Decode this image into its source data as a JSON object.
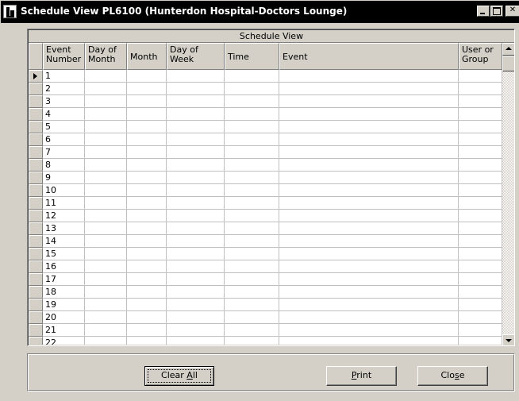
{
  "window": {
    "title": "Schedule View PL6100 (Hunterdon Hospital-Doctors Lounge)"
  },
  "grid": {
    "caption": "Schedule View",
    "columns": [
      {
        "label": "Event Number"
      },
      {
        "label": "Day of Month"
      },
      {
        "label": "Month"
      },
      {
        "label": "Day of Week"
      },
      {
        "label": "Time"
      },
      {
        "label": "Event"
      },
      {
        "label": "User or Group"
      }
    ],
    "rows": [
      "1",
      "2",
      "3",
      "4",
      "5",
      "6",
      "7",
      "8",
      "9",
      "10",
      "11",
      "12",
      "13",
      "14",
      "15",
      "16",
      "17",
      "18",
      "19",
      "20",
      "21",
      "22"
    ],
    "current_row": "1"
  },
  "buttons": {
    "clear_all": {
      "label": "Clear All",
      "mnemonic": "A"
    },
    "print": {
      "label": "Print",
      "mnemonic": "P"
    },
    "close": {
      "label": "Close",
      "mnemonic": "s"
    }
  }
}
